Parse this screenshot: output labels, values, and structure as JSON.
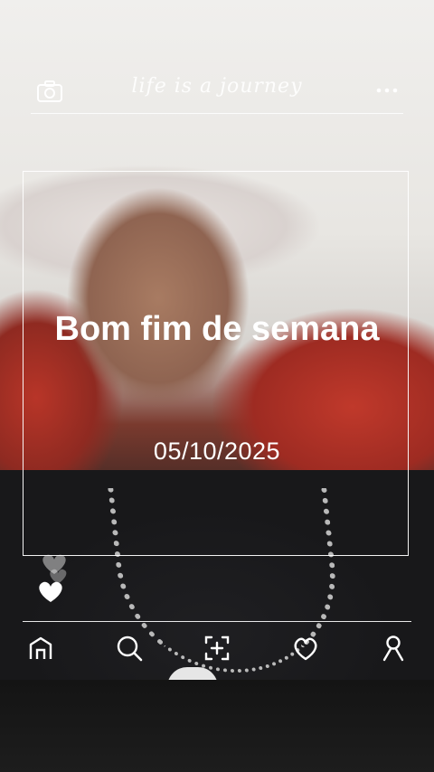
{
  "header": {
    "tagline": "life is a journey",
    "left_icon": "camera-icon",
    "right_icon": "more-icon"
  },
  "post": {
    "headline": "Bom fim de semana",
    "date": "05/10/2025"
  },
  "nav": {
    "items": [
      {
        "icon": "home-icon"
      },
      {
        "icon": "search-icon"
      },
      {
        "icon": "add-post-icon"
      },
      {
        "icon": "heart-icon"
      },
      {
        "icon": "profile-icon"
      }
    ]
  },
  "colors": {
    "overlay_text": "#ffffff"
  }
}
